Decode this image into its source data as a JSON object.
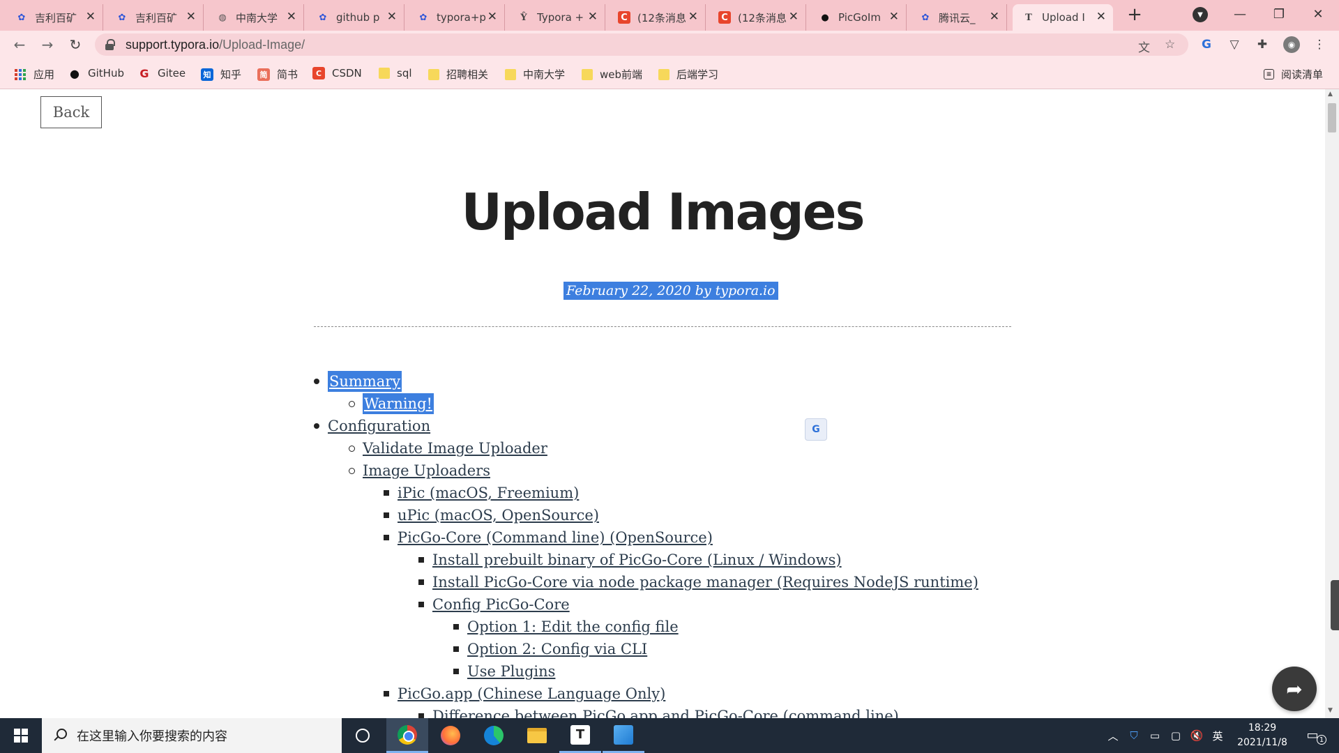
{
  "browser": {
    "tabs": [
      {
        "title": "吉利百矿",
        "icon": "baidu-paw-icon",
        "active": false
      },
      {
        "title": "吉利百矿",
        "icon": "baidu-paw-icon",
        "active": false
      },
      {
        "title": "中南大学",
        "icon": "globe-icon",
        "active": false
      },
      {
        "title": "github p",
        "icon": "baidu-paw-icon",
        "active": false
      },
      {
        "title": "typora+p",
        "icon": "baidu-paw-icon",
        "active": false
      },
      {
        "title": "Typora +",
        "icon": "typora-icon",
        "active": false
      },
      {
        "title": "(12条消息",
        "icon": "csdn-icon",
        "active": false
      },
      {
        "title": "(12条消息",
        "icon": "csdn-icon",
        "active": false
      },
      {
        "title": "PicGoIm",
        "icon": "github-icon",
        "active": false
      },
      {
        "title": "腾讯云_",
        "icon": "baidu-paw-icon",
        "active": false
      },
      {
        "title": "Upload I",
        "icon": "typora-icon",
        "active": true
      }
    ],
    "url": {
      "host": "support.typora.io",
      "path": "/Upload-Image/"
    },
    "bookmarks": [
      {
        "label": "应用",
        "icon": "apps-icon"
      },
      {
        "label": "GitHub",
        "icon": "github-icon"
      },
      {
        "label": "Gitee",
        "icon": "gitee-icon"
      },
      {
        "label": "知乎",
        "icon": "zhihu-icon"
      },
      {
        "label": "简书",
        "icon": "jianshu-icon"
      },
      {
        "label": "CSDN",
        "icon": "csdn-icon"
      },
      {
        "label": "sql",
        "icon": "folder-icon"
      },
      {
        "label": "招聘相关",
        "icon": "folder-icon"
      },
      {
        "label": "中南大学",
        "icon": "folder-icon"
      },
      {
        "label": "web前端",
        "icon": "folder-icon"
      },
      {
        "label": "后端学习",
        "icon": "folder-icon"
      }
    ],
    "reading_list": "阅读清单"
  },
  "page": {
    "back_label": "Back",
    "title": "Upload Images",
    "byline": "February 22, 2020 by typora.io",
    "toc": [
      {
        "label": "Summary",
        "level": 1,
        "selected": true
      },
      {
        "label": "Warning!",
        "level": 2,
        "selected": true
      },
      {
        "label": "Configuration",
        "level": 1,
        "selected": false
      },
      {
        "label": "Validate Image Uploader",
        "level": 2,
        "selected": false
      },
      {
        "label": "Image Uploaders",
        "level": 2,
        "selected": false
      },
      {
        "label": "iPic (macOS, Freemium)",
        "level": 3,
        "selected": false
      },
      {
        "label": "uPic (macOS, OpenSource)",
        "level": 3,
        "selected": false
      },
      {
        "label": "PicGo-Core (Command line) (OpenSource)",
        "level": 3,
        "selected": false
      },
      {
        "label": "Install prebuilt binary of PicGo-Core (Linux / Windows)",
        "level": 4,
        "selected": false
      },
      {
        "label": "Install PicGo-Core via node package manager (Requires NodeJS runtime)",
        "level": 4,
        "selected": false
      },
      {
        "label": "Config PicGo-Core",
        "level": 4,
        "selected": false
      },
      {
        "label": "Option 1: Edit the config file",
        "level": 5,
        "selected": false
      },
      {
        "label": "Option 2: Config via CLI",
        "level": 5,
        "selected": false
      },
      {
        "label": "Use Plugins",
        "level": 5,
        "selected": false
      },
      {
        "label": "PicGo.app (Chinese Language Only)",
        "level": 3,
        "selected": false
      },
      {
        "label": "Difference between PicGo.app and PicGo-Core (command line)",
        "level": 4,
        "selected": false
      }
    ]
  },
  "taskbar": {
    "search_placeholder": "在这里输入你要搜索的内容",
    "ime_label": "英",
    "time": "18:29",
    "date": "2021/11/8",
    "notification_count": "1"
  },
  "colors": {
    "tabstrip_bg": "#f6c6cc",
    "toolbar_bg": "#fde6e9",
    "selection": "#3d7fdf",
    "taskbar_bg": "#1f2a38"
  }
}
